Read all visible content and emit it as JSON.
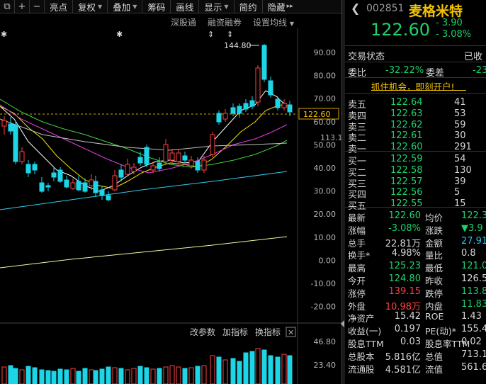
{
  "toolbar": {
    "icons": [
      "window-icon",
      "plus-icon",
      "minus-icon"
    ],
    "buttons": [
      {
        "label": "亮点",
        "caret": false
      },
      {
        "label": "复权",
        "caret": true
      },
      {
        "label": "叠加",
        "caret": true
      },
      {
        "label": "筹码",
        "caret": false
      },
      {
        "label": "画线",
        "caret": false
      },
      {
        "label": "显示",
        "caret": true
      },
      {
        "label": "简约",
        "caret": false
      },
      {
        "label": "隐藏",
        "caret": false
      }
    ],
    "more": "▸▸"
  },
  "subbar": {
    "items": [
      "深股通",
      "融资融券",
      "设置均线"
    ]
  },
  "chart": {
    "price_axis": [
      "90.00",
      "80.00",
      "70.00",
      "60.00",
      "50.00",
      "40.00",
      "30.00",
      "20.00",
      "10.00",
      "0.00",
      "-10.00",
      "-20.00"
    ],
    "current_price_tag": "122.60",
    "second_tag": "113.13",
    "peak_label": "144.80",
    "volume_axis": [
      "46.80",
      "23.40"
    ],
    "indicator_tabs": [
      "改参数",
      "加指标",
      "换指标"
    ],
    "colors": {
      "up": "#ff4040",
      "down": "#1cd6e8",
      "ma5": "#ffffff",
      "ma10": "#f5e400",
      "ma20": "#e040e0",
      "ma30": "#40d040",
      "ma60": "#c0c0c0",
      "ma120": "#33ccee",
      "ma250": "#f5f5a0"
    }
  },
  "quote": {
    "code": "002851",
    "name": "麦格米特",
    "price": "122.60",
    "change": "- 3.90",
    "change_pct": "- 3.08%",
    "section_title": "交易状态",
    "section_right": "已收",
    "ratio_label": "委比",
    "ratio_value": "-32.22%",
    "diff_label": "委差",
    "diff_value": "-23",
    "promo": "抓住机会，即刻开户!",
    "asks": [
      {
        "label": "卖五",
        "price": "122.64",
        "vol": "41"
      },
      {
        "label": "卖四",
        "price": "122.63",
        "vol": "53"
      },
      {
        "label": "卖三",
        "price": "122.62",
        "vol": "59"
      },
      {
        "label": "卖二",
        "price": "122.61",
        "vol": "30"
      },
      {
        "label": "卖一",
        "price": "122.60",
        "vol": "291"
      }
    ],
    "bids": [
      {
        "label": "买一",
        "price": "122.59",
        "vol": "54"
      },
      {
        "label": "买二",
        "price": "122.58",
        "vol": "130"
      },
      {
        "label": "买三",
        "price": "122.57",
        "vol": "39"
      },
      {
        "label": "买四",
        "price": "122.56",
        "vol": "5"
      },
      {
        "label": "买五",
        "price": "122.55",
        "vol": "15"
      }
    ],
    "stats": [
      {
        "l1": "最新",
        "v1": "122.60",
        "c1": "g",
        "l2": "均价",
        "v2": "122.3",
        "c2": "g"
      },
      {
        "l1": "涨幅",
        "v1": "-3.08%",
        "c1": "g",
        "l2": "涨跌",
        "v2": "▼3.9",
        "c2": "g"
      },
      {
        "l1": "总手",
        "v1": "22.81万",
        "c1": "w",
        "l2": "金额",
        "v2": "27.91",
        "c2": "c"
      },
      {
        "l1": "换手*",
        "v1": "4.98%",
        "c1": "w",
        "l2": "量比",
        "v2": "0.8",
        "c2": "w"
      },
      {
        "l1": "最高",
        "v1": "125.23",
        "c1": "g",
        "l2": "最低",
        "v2": "121.0",
        "c2": "g"
      },
      {
        "l1": "今开",
        "v1": "124.80",
        "c1": "g",
        "l2": "昨收",
        "v2": "126.5",
        "c2": "w"
      },
      {
        "l1": "涨停",
        "v1": "139.15",
        "c1": "r",
        "l2": "跌停",
        "v2": "113.8",
        "c2": "g"
      },
      {
        "l1": "外盘",
        "v1": "10.98万",
        "c1": "r",
        "l2": "内盘",
        "v2": "11.83",
        "c2": "g"
      },
      {
        "l1": "净资产",
        "v1": "15.42",
        "c1": "w",
        "l2": "ROE",
        "v2": "1.43",
        "c2": "w"
      },
      {
        "l1": "收益(一)",
        "v1": "0.197",
        "c1": "w",
        "l2": "PE(动)*",
        "v2": "155.4",
        "c2": "w"
      },
      {
        "l1": "股息TTM",
        "v1": "0.03",
        "c1": "w",
        "l2": "股息率TTM",
        "v2": "0.02",
        "c2": "w"
      },
      {
        "l1": "总股本",
        "v1": "5.816亿",
        "c1": "w",
        "l2": "总值",
        "v2": "713.1",
        "c2": "w"
      },
      {
        "l1": "流通股",
        "v1": "4.581亿",
        "c1": "w",
        "l2": "流值",
        "v2": "561.6",
        "c2": "w"
      }
    ]
  }
}
